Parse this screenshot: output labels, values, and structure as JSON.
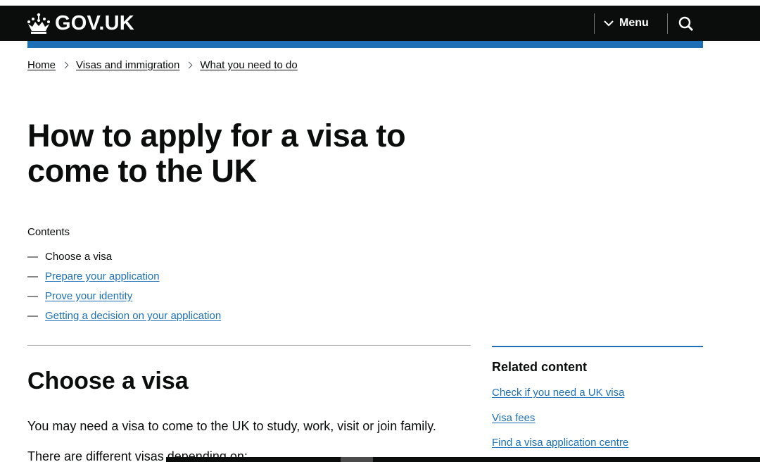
{
  "header": {
    "logo_text": "GOV.UK",
    "menu_label": "Menu",
    "search_icon": "search-icon",
    "crown_icon": "crown-icon",
    "background": "#0b0c0c",
    "accent": "#1d70b8"
  },
  "breadcrumb": {
    "items": [
      "Home",
      "Visas and immigration",
      "What you need to do"
    ]
  },
  "page": {
    "title": "How to apply for a visa to come to the UK"
  },
  "contents": {
    "heading": "Contents",
    "items": [
      {
        "label": "Choose a visa",
        "current": true
      },
      {
        "label": "Prepare your application",
        "current": false
      },
      {
        "label": "Prove your identity",
        "current": false
      },
      {
        "label": "Getting a decision on your application",
        "current": false
      }
    ]
  },
  "main": {
    "section_heading": "Choose a visa",
    "paragraph": "You may need a visa to come to the UK to study, work, visit or join family.",
    "paragraph2": "There are different visas depending on:"
  },
  "related": {
    "heading": "Related content",
    "links": [
      "Check if you need a UK visa",
      "Visa fees",
      "Find a visa application centre"
    ]
  }
}
